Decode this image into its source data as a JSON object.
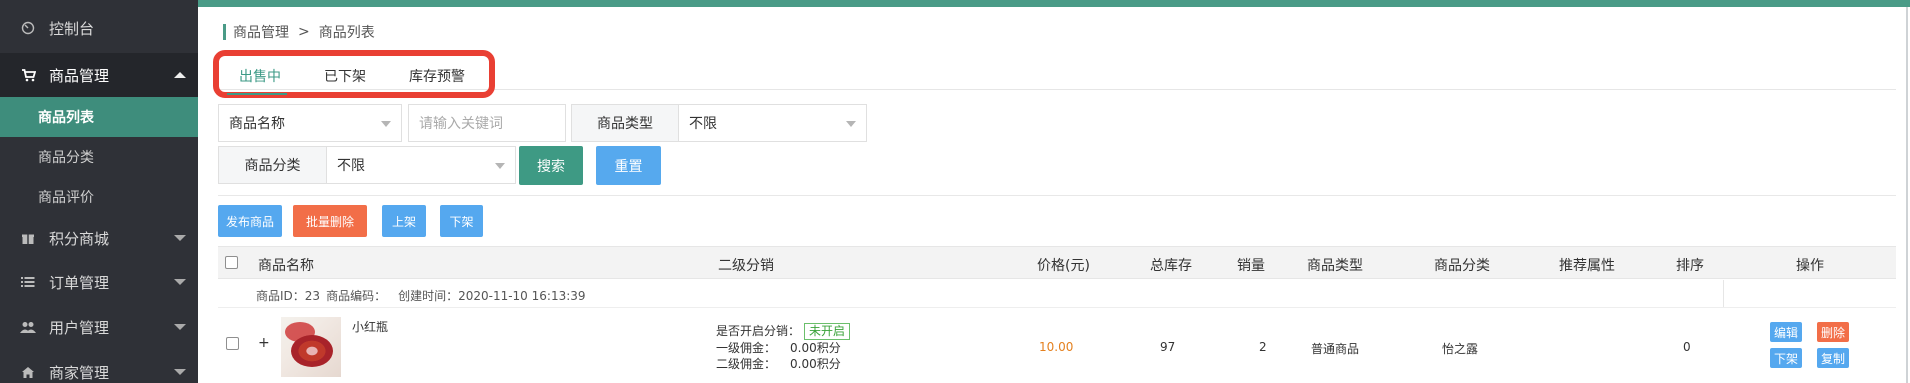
{
  "sidebar": {
    "items": [
      {
        "label": "控制台",
        "icon": "dashboard-icon"
      },
      {
        "label": "商品管理",
        "icon": "cart-icon"
      },
      {
        "label": "积分商城",
        "icon": "gift-icon"
      },
      {
        "label": "订单管理",
        "icon": "list-icon"
      },
      {
        "label": "用户管理",
        "icon": "users-icon"
      },
      {
        "label": "商家管理",
        "icon": "store-icon"
      }
    ],
    "sub_items": [
      "商品列表",
      "商品分类",
      "商品评价"
    ]
  },
  "breadcrumb": {
    "parent": "商品管理",
    "separator": ">",
    "current": "商品列表"
  },
  "tabs": [
    "出售中",
    "已下架",
    "库存预警"
  ],
  "filters": {
    "field_select": "商品名称",
    "keyword_placeholder": "请输入关键词",
    "type_label": "商品类型",
    "type_value": "不限",
    "category_label": "商品分类",
    "category_value": "不限",
    "search_label": "搜索",
    "reset_label": "重置"
  },
  "actions": {
    "publish": "发布商品",
    "bulk_delete": "批量删除",
    "on_shelf": "上架",
    "off_shelf": "下架"
  },
  "table": {
    "headers": [
      "商品名称",
      "二级分销",
      "价格(元)",
      "总库存",
      "销量",
      "商品类型",
      "商品分类",
      "推荐属性",
      "排序",
      "操作"
    ],
    "rows": [
      {
        "meta": {
          "id": "商品ID：23",
          "code": "商品编码：",
          "created": "创建时间：2020-11-10 16:13:39"
        },
        "expand": "+",
        "name": "小红瓶",
        "dist_label": "是否开启分销：",
        "dist_status": "未开启",
        "level1_label": "一级佣金：",
        "level1_value": "0.00积分",
        "level2_label": "二级佣金：",
        "level2_value": "0.00积分",
        "price": "10.00",
        "stock": "97",
        "sales": "2",
        "type": "普通商品",
        "category": "怡之露",
        "recommend": "",
        "sort": "0",
        "ops": {
          "edit": "编辑",
          "delete": "删除",
          "off_shelf": "下架",
          "copy": "复制"
        }
      }
    ]
  },
  "colors": {
    "accent": "#3e8d7c",
    "highlight_border": "#e93f33",
    "blue_button": "#55a8ef",
    "orange_button": "#f26e48",
    "price": "#e4801e"
  }
}
